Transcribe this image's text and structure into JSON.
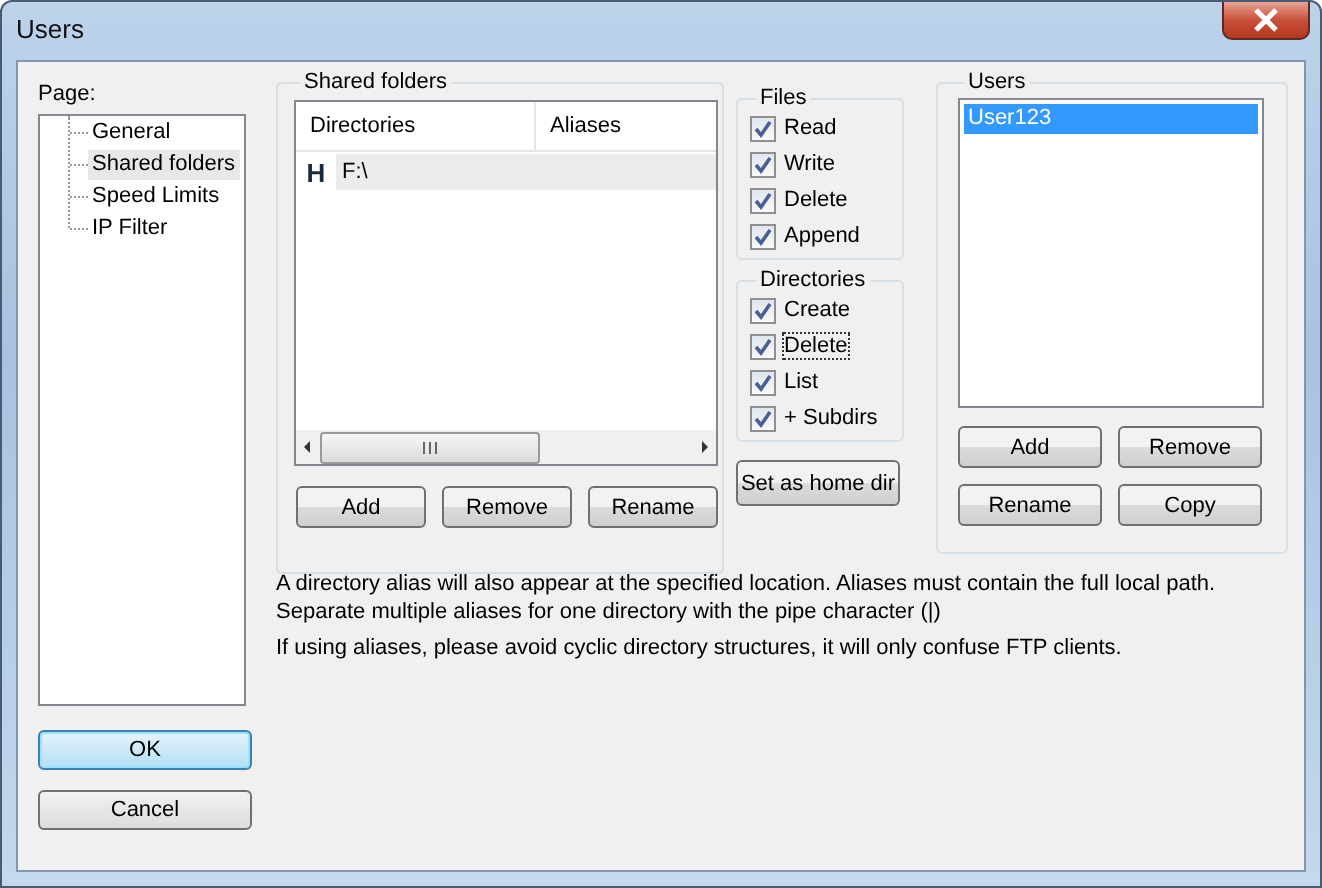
{
  "window": {
    "title": "Users"
  },
  "page_panel": {
    "label": "Page:",
    "items": [
      {
        "label": "General",
        "selected": false
      },
      {
        "label": "Shared folders",
        "selected": true
      },
      {
        "label": "Speed Limits",
        "selected": false
      },
      {
        "label": "IP Filter",
        "selected": false
      }
    ]
  },
  "shared_folders": {
    "title": "Shared folders",
    "columns": [
      "Directories",
      "Aliases"
    ],
    "rows": [
      {
        "marker": "H",
        "directory": "F:\\",
        "selected": true
      }
    ],
    "buttons": [
      "Add",
      "Remove",
      "Rename"
    ]
  },
  "files": {
    "title": "Files",
    "options": [
      {
        "label": "Read",
        "checked": true,
        "focused": false
      },
      {
        "label": "Write",
        "checked": true,
        "focused": false
      },
      {
        "label": "Delete",
        "checked": true,
        "focused": false
      },
      {
        "label": "Append",
        "checked": true,
        "focused": false
      }
    ]
  },
  "directories": {
    "title": "Directories",
    "options": [
      {
        "label": "Create",
        "checked": true,
        "focused": false
      },
      {
        "label": "Delete",
        "checked": true,
        "focused": true
      },
      {
        "label": "List",
        "checked": true,
        "focused": false
      },
      {
        "label": "+ Subdirs",
        "checked": true,
        "focused": false
      }
    ]
  },
  "home_button": "Set as home dir",
  "users": {
    "title": "Users",
    "items": [
      {
        "name": "User123",
        "selected": true
      }
    ],
    "buttons": [
      "Add",
      "Remove",
      "Rename",
      "Copy"
    ]
  },
  "notes": [
    "A directory alias will also appear at the specified location. Aliases must contain the full local path. Separate multiple aliases for one directory with the pipe character (|)",
    "If using aliases, please avoid cyclic directory structures, it will only confuse FTP clients."
  ],
  "dialog_buttons": [
    {
      "label": "OK",
      "default": true
    },
    {
      "label": "Cancel",
      "default": false
    }
  ]
}
